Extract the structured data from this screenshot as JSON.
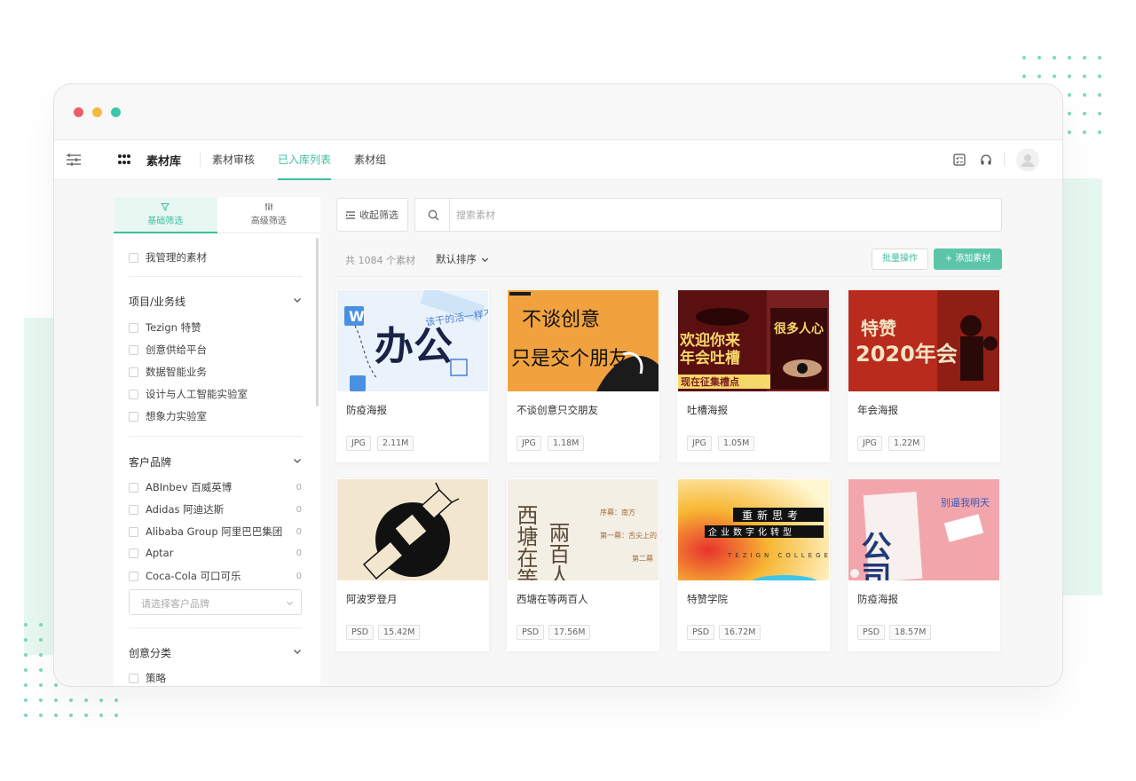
{
  "window": {
    "traffic_colors": [
      "#ec5f63",
      "#f5b940",
      "#3fc6a8"
    ]
  },
  "header": {
    "app_title": "素材库",
    "nav": [
      "素材审核",
      "已入库列表",
      "素材组"
    ],
    "active_nav": "已入库列表",
    "accent": "#3cbf9f",
    "right_icons": [
      "checklist-icon",
      "headset-icon",
      "user-avatar-icon"
    ]
  },
  "filters": {
    "tabs": [
      {
        "label": "基础筛选",
        "icon": "filter-icon",
        "active": true
      },
      {
        "label": "高级筛选",
        "icon": "sliders-icon",
        "active": false
      }
    ],
    "my_assets_label": "我管理的素材",
    "project_section": {
      "title": "项目/业务线",
      "items": [
        "Tezign 特赞",
        "创意供给平台",
        "数据智能业务",
        "设计与人工智能实验室",
        "想象力实验室"
      ]
    },
    "brand_section": {
      "title": "客户品牌",
      "items": [
        {
          "label": "ABInbev 百威英博",
          "count": "0"
        },
        {
          "label": "Adidas 阿迪达斯",
          "count": "0"
        },
        {
          "label": "Alibaba Group 阿里巴巴集团",
          "count": "0"
        },
        {
          "label": "Aptar",
          "count": "0"
        },
        {
          "label": "Coca-Cola 可口可乐",
          "count": "0"
        }
      ],
      "select_placeholder": "请选择客户品牌"
    },
    "creative_section": {
      "title": "创意分类",
      "items": [
        "策略"
      ]
    }
  },
  "toolbar": {
    "collapse_label": "收起筛选",
    "search_placeholder": "搜索素材",
    "total_text": "共 1084 个素材",
    "sort_label": "默认排序",
    "batch_label": "批量操作",
    "add_label": "+ 添加素材"
  },
  "assets": [
    {
      "title": "防疫海报",
      "format": "JPG",
      "size": "2.11M"
    },
    {
      "title": "不谈创意只交朋友",
      "format": "JPG",
      "size": "1.18M"
    },
    {
      "title": "吐槽海报",
      "format": "JPG",
      "size": "1.05M"
    },
    {
      "title": "年会海报",
      "format": "JPG",
      "size": "1.22M"
    },
    {
      "title": "阿波罗登月",
      "format": "PSD",
      "size": "15.42M"
    },
    {
      "title": "西塘在等两百人",
      "format": "PSD",
      "size": "17.56M"
    },
    {
      "title": "特赞学院",
      "format": "PSD",
      "size": "16.72M"
    },
    {
      "title": "防疫海报",
      "format": "PSD",
      "size": "18.57M"
    }
  ],
  "thumb_text": {
    "t1": {
      "big": "办公",
      "hand": "该干的活一样不少心"
    },
    "t2": {
      "line1": "不谈创意",
      "line2": "只是交个朋友"
    },
    "t3": {
      "line1": "欢迎你来",
      "line2": "年会吐槽",
      "side": "很多人心",
      "bar": "现在征集槽点"
    },
    "t4": {
      "top": "特赞",
      "year": "2020年会"
    },
    "t6": {
      "big": "西塘在等",
      "big2": "兩百人",
      "p1": "序幕：南方",
      "p2": "第一幕：舌尖上的",
      "p3": "第二幕"
    },
    "t7": {
      "l1": "重新思考",
      "l2": "企业数字化转型",
      "l3": "TEZIGN COLLEGE"
    },
    "t8": {
      "big": "公司",
      "hand": "别逼我明天"
    }
  }
}
